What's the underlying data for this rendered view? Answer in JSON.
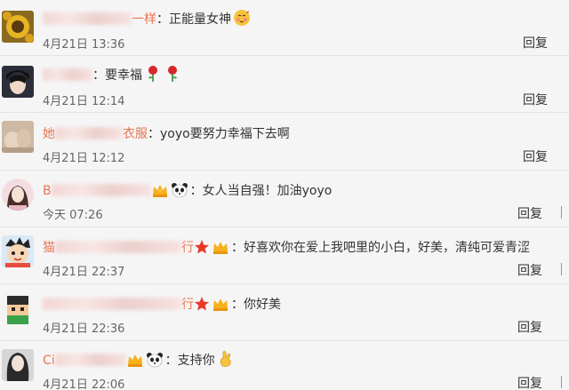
{
  "reply_label": "回复",
  "comments": [
    {
      "name_visible": "一样",
      "separator": "：",
      "content": "正能量女神",
      "time": "4月21日 13:36",
      "avatar": "sunflower-avatar",
      "emoji": "blush-emoji"
    },
    {
      "name_visible": "",
      "separator": "：",
      "content": "要幸福",
      "time": "4月21日 12:14",
      "avatar": "anime-boy-avatar",
      "emoji": "rose-emoji"
    },
    {
      "name_visible_prefix": "她",
      "name_visible_suffix": "衣服",
      "separator": "：",
      "content": "yoyo要努力幸福下去啊",
      "time": "4月21日 12:12",
      "avatar": "photo-avatar"
    },
    {
      "name_visible": "B",
      "separator": "：",
      "content": "女人当自强！加油yoyo",
      "time": "今天 07:26",
      "avatar": "girl-avatar",
      "badges": [
        "vip-crown-icon",
        "panda-icon"
      ]
    },
    {
      "name_visible_prefix": "猫",
      "name_visible_suffix": "行",
      "separator": "：",
      "content": "好喜欢你在爱上我吧里的小白，好美，清纯可爱青涩",
      "time": "4月21日 22:37",
      "avatar": "cartoon-avatar",
      "badges": [
        "star-badge-icon",
        "vip-crown-icon"
      ]
    },
    {
      "name_visible_suffix": "行",
      "separator": "：",
      "content": "你好美",
      "time": "4月21日 22:36",
      "avatar": "pixel-avatar",
      "badges": [
        "star-badge-icon",
        "vip-crown-icon"
      ]
    },
    {
      "name_visible_prefix": "Ci",
      "separator": "：",
      "content": "支持你",
      "time": "4月21日 22:06",
      "avatar": "long-hair-girl-avatar",
      "badges": [
        "vip-crown-icon",
        "panda-icon"
      ],
      "emoji": "hand-emoji"
    }
  ]
}
